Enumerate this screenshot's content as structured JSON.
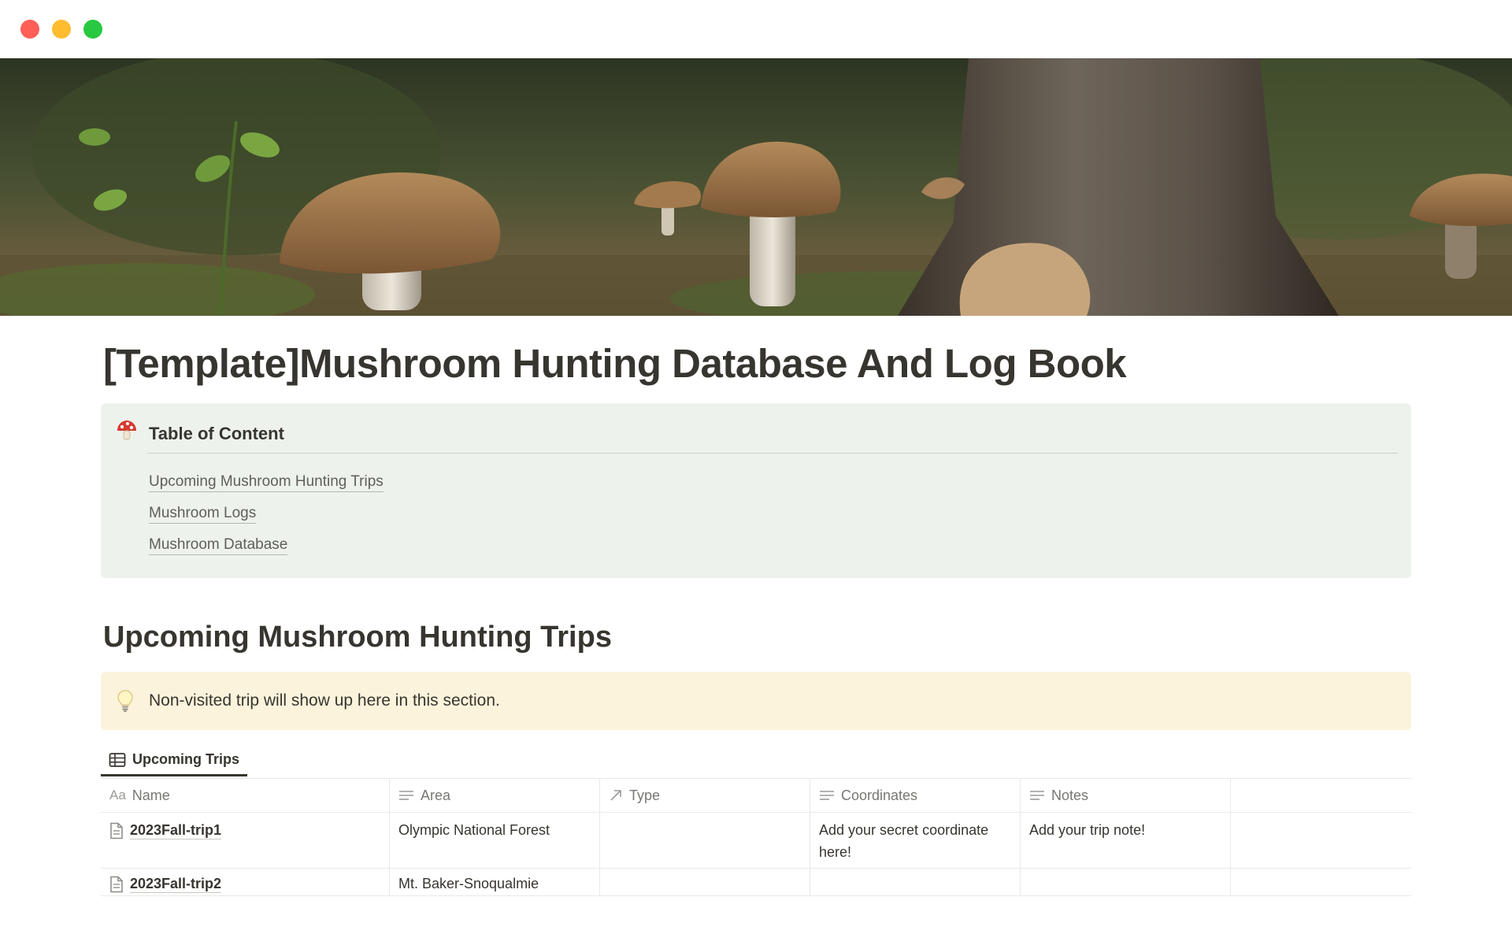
{
  "window": {
    "controls": [
      "close",
      "minimize",
      "zoom"
    ]
  },
  "cover": {
    "icon": "mushroom-forest-photo"
  },
  "page": {
    "title": "[Template]Mushroom Hunting Database And Log Book"
  },
  "toc": {
    "icon": "mushroom-icon",
    "title": "Table of Content",
    "links": [
      "Upcoming Mushroom Hunting Trips",
      "Mushroom Logs",
      "Mushroom Database"
    ]
  },
  "section": {
    "heading": "Upcoming Mushroom Hunting Trips",
    "callout_icon": "lightbulb-icon",
    "callout_text": "Non-visited trip will show up here in this section."
  },
  "view": {
    "tab_label": "Upcoming Trips",
    "tab_icon": "table-icon"
  },
  "table": {
    "columns": [
      {
        "prefix": "Aa",
        "label": "Name"
      },
      {
        "icon": "text-lines-icon",
        "label": "Area"
      },
      {
        "icon": "arrow-up-right-icon",
        "label": "Type"
      },
      {
        "icon": "text-lines-icon",
        "label": "Coordinates"
      },
      {
        "icon": "text-lines-icon",
        "label": "Notes"
      }
    ],
    "rows": [
      {
        "name": "2023Fall-trip1",
        "area": "Olympic National Forest",
        "type": "",
        "coordinates": "Add your secret coordinate here!",
        "notes": "Add your trip note!"
      },
      {
        "name": "2023Fall-trip2",
        "area": "Mt. Baker-Snoqualmie",
        "type": "",
        "coordinates": "",
        "notes": ""
      }
    ]
  },
  "colors": {
    "toc_bg": "#edf3ec",
    "callout_bg": "#fbf3db",
    "text": "#37352f",
    "muted": "#787774"
  }
}
